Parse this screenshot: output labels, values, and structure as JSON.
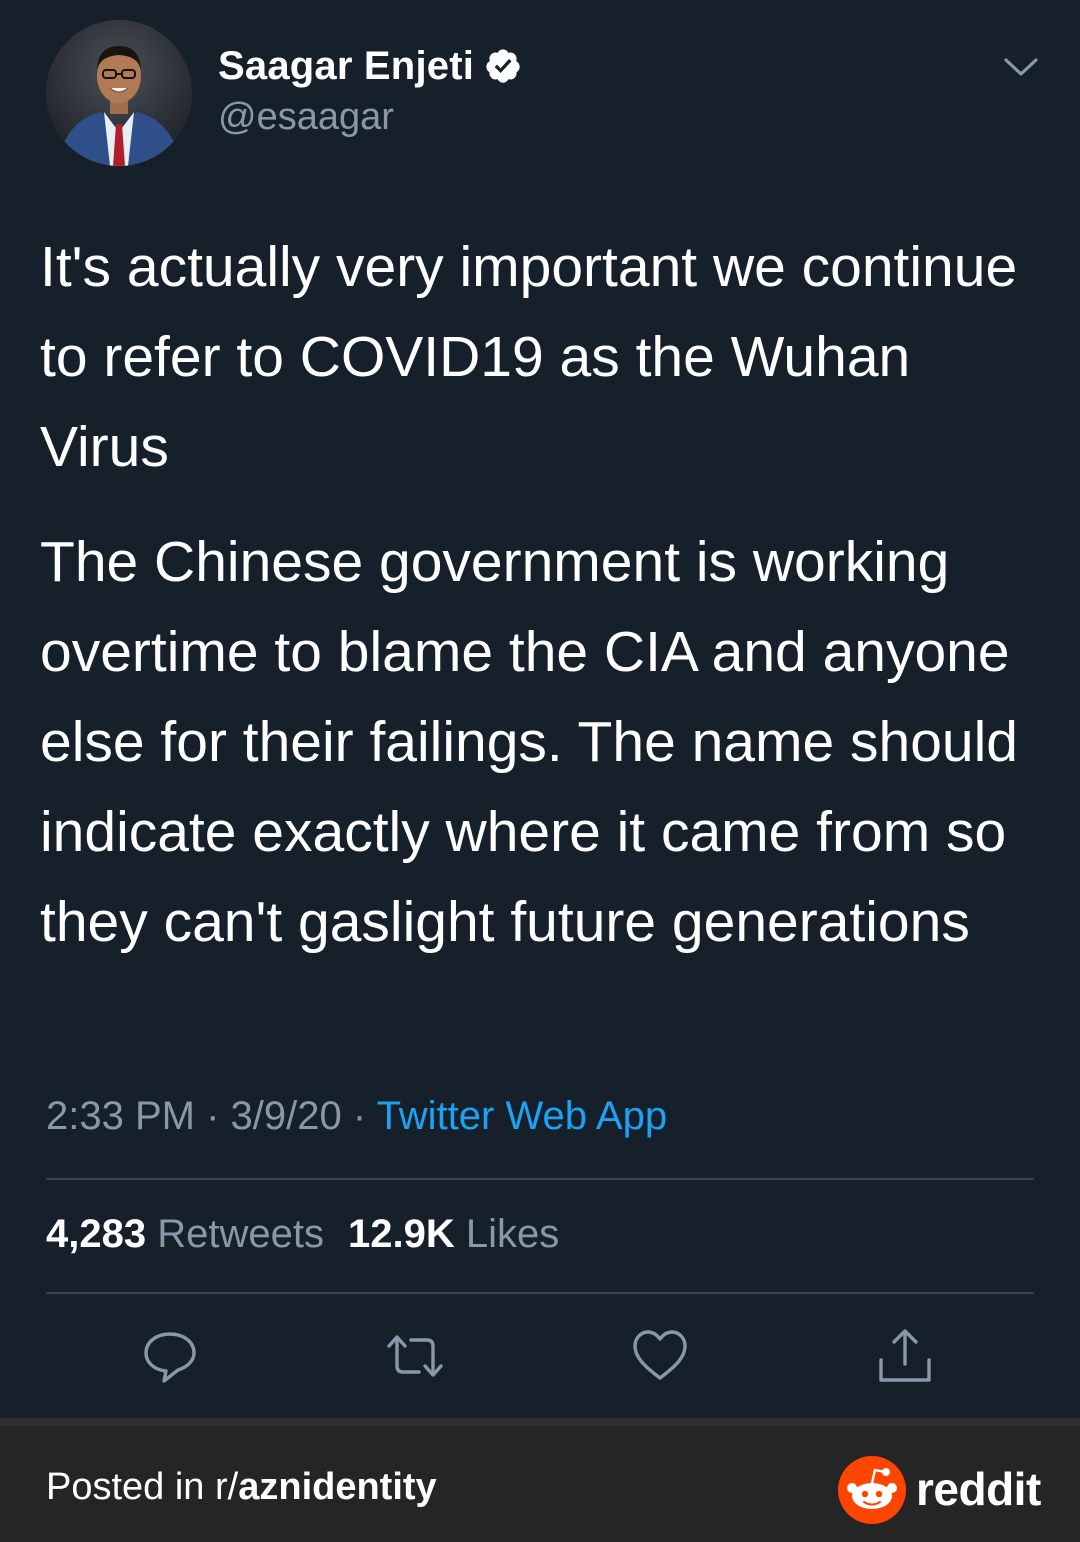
{
  "tweet": {
    "author_name": "Saagar Enjeti",
    "handle": "@esaagar",
    "paragraphs": [
      "It's actually very important we continue to refer to COVID19 as the Wuhan Virus",
      "The Chinese government is working overtime to blame the CIA and anyone else for their failings. The name should indicate exactly where it came from so they can't gaslight future generations"
    ],
    "time": "2:33 PM",
    "date": "3/9/20",
    "source": "Twitter Web App",
    "separator": " · ",
    "retweets_count": "4,283",
    "retweets_label": "Retweets",
    "likes_count": "12.9K",
    "likes_label": "Likes"
  },
  "icons": {
    "verified": "verified-badge-icon",
    "caret": "chevron-down-icon",
    "reply": "reply-icon",
    "retweet": "retweet-icon",
    "like": "heart-icon",
    "share": "share-icon",
    "reddit": "reddit-logo-icon"
  },
  "footer": {
    "posted_prefix": "Posted in r/",
    "subreddit": "aznidentity",
    "brand": "reddit"
  },
  "colors": {
    "background": "#15202b",
    "secondary_text": "#8899a6",
    "link": "#1da1f2",
    "divider": "#38444d",
    "footer_bg": "#252525",
    "reddit_orange": "#ff4500"
  }
}
